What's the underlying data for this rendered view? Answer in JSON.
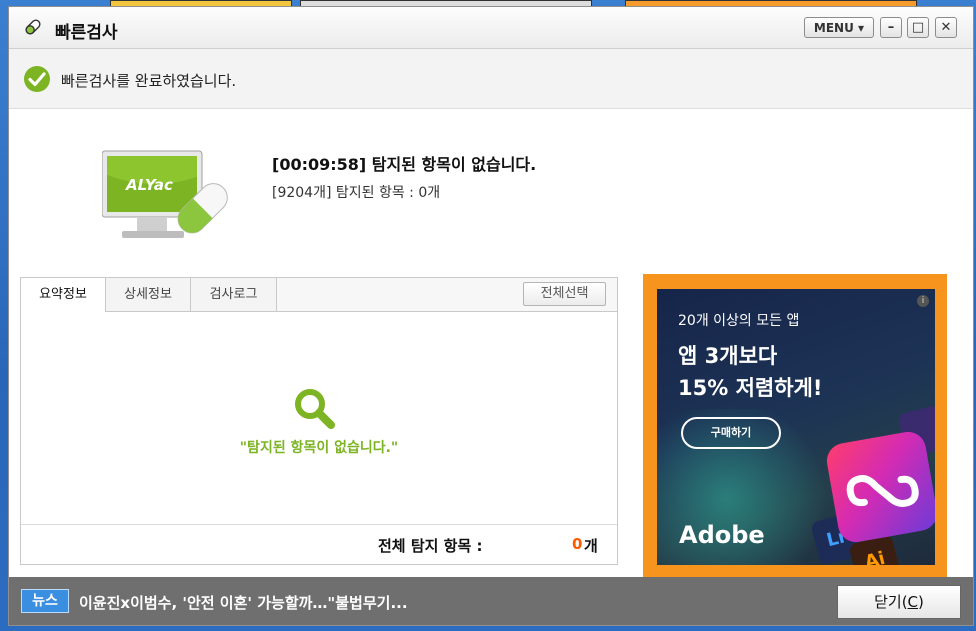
{
  "window": {
    "title": "빠른검사",
    "menu_label": "MENU ▾",
    "minimize_glyph": "–",
    "maximize_glyph": "□",
    "close_glyph": "✕"
  },
  "status": {
    "message": "빠른검사를 완료하였습니다."
  },
  "result": {
    "title": "[00:09:58]  탐지된 항목이 없습니다.",
    "subtitle": "[9204개] 탐지된 항목 : 0개",
    "logo_text": "ALYac"
  },
  "tabs": [
    {
      "label": "요약정보",
      "active": true
    },
    {
      "label": "상세정보",
      "active": false
    },
    {
      "label": "검사로그",
      "active": false
    }
  ],
  "select_all_label": "전체선택",
  "empty_message": "\"탐지된 항목이 없습니다.\"",
  "summary": {
    "label": "전체 탐지 항목 :",
    "count": "0",
    "unit": "개"
  },
  "ad": {
    "line1": "20개 이상의 모든 앱",
    "line2": "앱 3개보다",
    "line3": "15% 저렴하게!",
    "button_label": "구매하기",
    "brand": "Adobe",
    "info_glyph": "i",
    "tile_lr": "Lr",
    "tile_ai": "Ai"
  },
  "news": {
    "badge": "뉴스",
    "headline": "이윤진x이범수, '안전 이혼' 가능할까…\"불법무기..."
  },
  "close_button": {
    "label_pre": "닫기(",
    "accel": "C",
    "label_post": ")"
  },
  "colors": {
    "accent_green": "#7cb423",
    "count_orange": "#ff5a00",
    "ad_frame": "#f7941d",
    "news_blue": "#3b8fe0"
  }
}
